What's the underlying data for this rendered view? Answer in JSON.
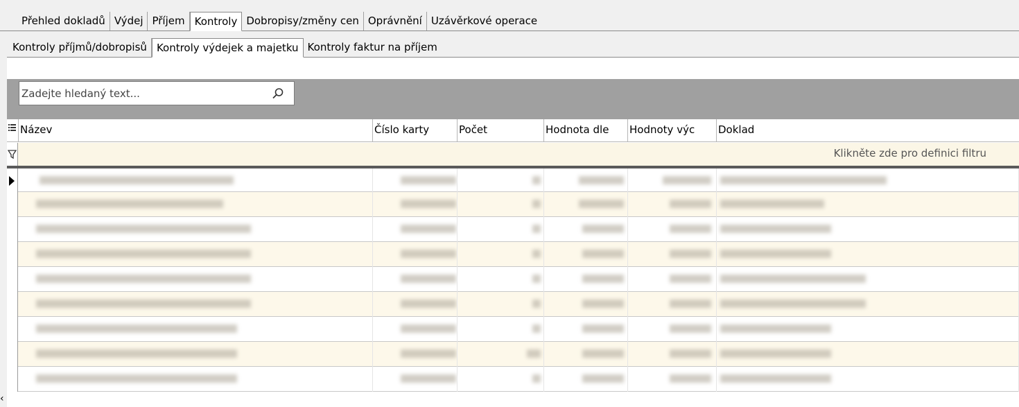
{
  "top_tabs": [
    {
      "label": "Přehled dokladů",
      "active": false
    },
    {
      "label": "Výdej",
      "active": false
    },
    {
      "label": "Příjem",
      "active": false
    },
    {
      "label": "Kontroly",
      "active": true
    },
    {
      "label": "Dobropisy/změny cen",
      "active": false
    },
    {
      "label": "Oprávnění",
      "active": false
    },
    {
      "label": "Uzávěrkové operace",
      "active": false
    }
  ],
  "sub_tabs": [
    {
      "label": "Kontroly příjmů/dobropisů",
      "active": false
    },
    {
      "label": "Kontroly výdejek a majetku",
      "active": true
    },
    {
      "label": "Kontroly faktur na příjem",
      "active": false
    }
  ],
  "search": {
    "placeholder": "Zadejte hledaný text..."
  },
  "grid": {
    "columns": [
      "Název",
      "Číslo karty",
      "Počet",
      "Hodnota dle",
      "Hodnoty výc",
      "Doklad"
    ],
    "filter_hint": "Klikněte zde pro definici filtru",
    "row_count_visible": 9
  }
}
